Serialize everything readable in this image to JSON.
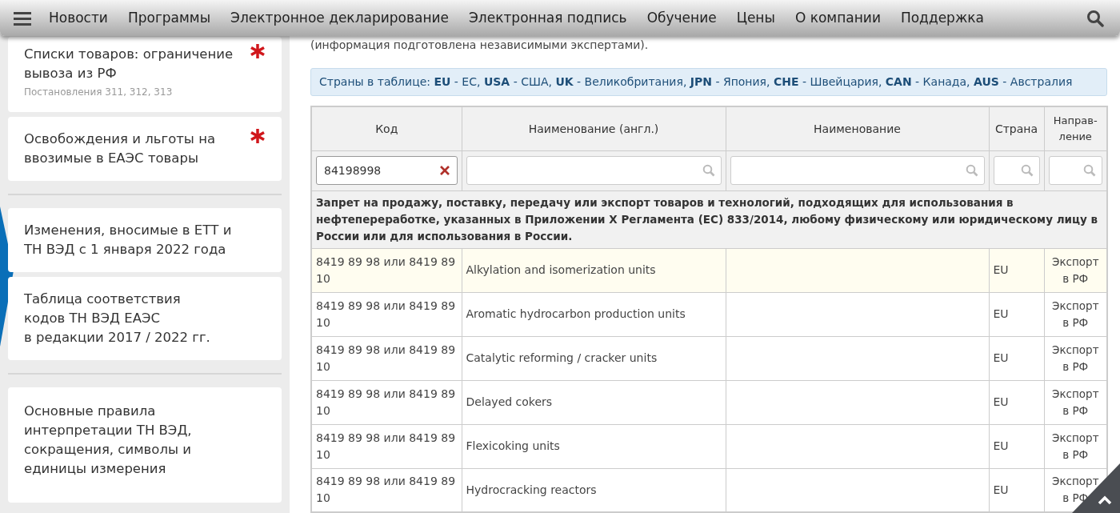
{
  "nav": {
    "items": [
      "Новости",
      "Программы",
      "Электронное декларирование",
      "Электронная подпись",
      "Обучение",
      "Цены",
      "О компании",
      "Поддержка"
    ]
  },
  "sidebar": {
    "groups": [
      [
        {
          "title": "Списки товаров: ограничение вывоза из РФ",
          "subtitle": "Постановления 311, 312, 313",
          "starred": true
        },
        {
          "title": "Освобождения и льготы на ввозимые в ЕАЭС товары",
          "starred": true
        }
      ],
      [
        {
          "title": "Изменения, вносимые в ЕТТ и ТН ВЭД с 1 января 2022 года",
          "starred": false
        },
        {
          "title": "Таблица соответствия\nкодов ТН ВЭД ЕАЭС\nв редакции 2017 / 2022 гг.",
          "starred": false
        }
      ],
      [
        {
          "title": "Основные правила интерпретации ТН ВЭД, сокращения, символы и единицы измерения",
          "starred": false
        }
      ]
    ]
  },
  "intro": "(информация подготовлена независимыми экспертами).",
  "countries_note": "Страны в таблице: **EU** - ЕС, **USA** - США, **UK** - Великобритания, **JPN** - Япония, **CHE** - Швейцария, **CAN** - Канада, **AUS** - Австралия",
  "table": {
    "columns": [
      "Код",
      "Наименование (англ.)",
      "Наименование",
      "Страна",
      "Направ-\nление"
    ],
    "filter_value": "84198998",
    "group": "Запрет на продажу, поставку, передачу или экспорт товаров и технологий, подходящих для использования в нефтепереработке, указанных в Приложении X Регламента (ЕС) 833/2014, любому физическому или юридическому лицу в России или для использования в России.",
    "rows": [
      {
        "code": "8419 89 98 или 8419 89 10",
        "name_en": "Alkylation and isomerization units",
        "country": "EU",
        "direction": "Экспорт в РФ",
        "highlighted": true
      },
      {
        "code": "8419 89 98 или 8419 89 10",
        "name_en": "Aromatic hydrocarbon production units",
        "country": "EU",
        "direction": "Экспорт в РФ",
        "highlighted": false
      },
      {
        "code": "8419 89 98 или 8419 89 10",
        "name_en": "Catalytic reforming / cracker units",
        "country": "EU",
        "direction": "Экспорт в РФ",
        "highlighted": false
      },
      {
        "code": "8419 89 98 или 8419 89 10",
        "name_en": "Delayed cokers",
        "country": "EU",
        "direction": "Экспорт в РФ",
        "highlighted": false
      },
      {
        "code": "8419 89 98 или 8419 89 10",
        "name_en": "Flexicoking units",
        "country": "EU",
        "direction": "Экспорт в РФ",
        "highlighted": false
      },
      {
        "code": "8419 89 98 или 8419 89 10",
        "name_en": "Hydrocracking reactors",
        "country": "EU",
        "direction": "Экспорт в РФ",
        "highlighted": false
      }
    ]
  }
}
